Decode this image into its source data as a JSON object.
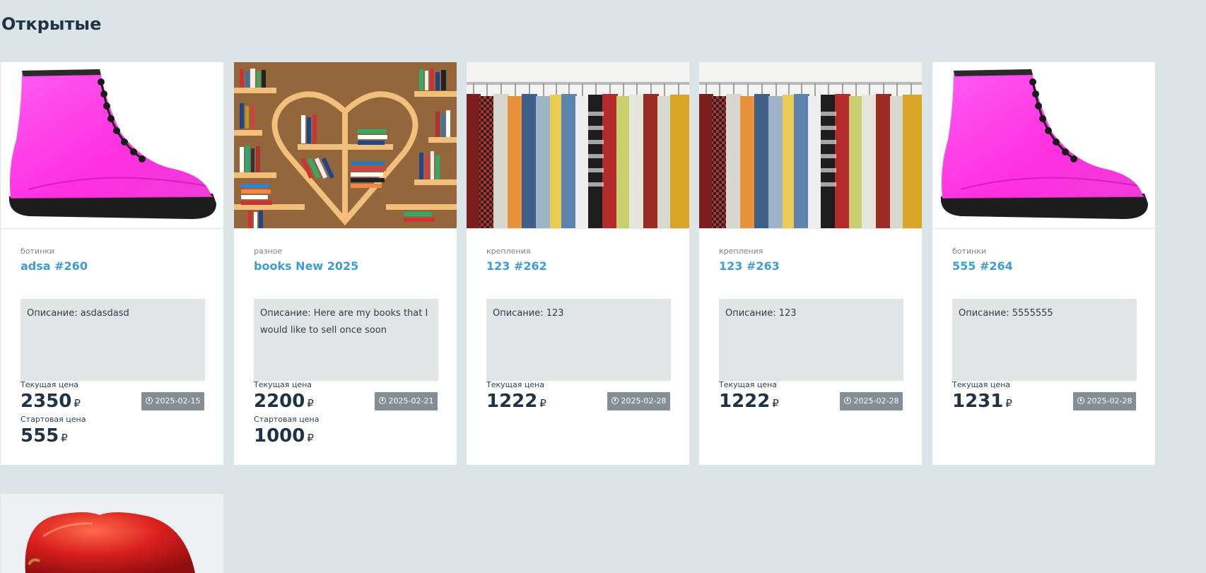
{
  "section": {
    "title": "Открытые"
  },
  "labels": {
    "current_price": "Текущая цена",
    "start_price": "Стартовая цена",
    "currency": "₽",
    "description_prefix": "Описание:"
  },
  "cards": [
    {
      "image": "pink-boot-photo",
      "category": "ботинки",
      "title": "adsa #260",
      "description": "Описание: asdasdasd",
      "current_price": "2350",
      "start_price": "555",
      "end_date": "2025-02-15"
    },
    {
      "image": "bookshelf-heart-photo",
      "category": "разное",
      "title": "books New 2025",
      "description": "Описание: Here are my books that I would like to sell once soon",
      "current_price": "2200",
      "start_price": "1000",
      "end_date": "2025-02-21"
    },
    {
      "image": "clothes-rack-photo",
      "category": "крепления",
      "title": "123 #262",
      "description": "Описание: 123",
      "current_price": "1222",
      "end_date": "2025-02-28"
    },
    {
      "image": "clothes-rack-photo",
      "category": "крепления",
      "title": "123 #263",
      "description": "Описание: 123",
      "current_price": "1222",
      "end_date": "2025-02-28"
    },
    {
      "image": "pink-boot-photo",
      "category": "ботинки",
      "title": "555 #264",
      "description": "Описание: 5555555",
      "current_price": "1231",
      "end_date": "2025-02-28"
    }
  ],
  "partial_card": {
    "image": "red-apple-photo"
  },
  "colors": {
    "page_bg": "#dbe5e8",
    "title_link": "#3d9cd5",
    "price_text": "#1f3344",
    "badge_bg": "#868e94",
    "desc_bg": "#e1e5e6"
  }
}
